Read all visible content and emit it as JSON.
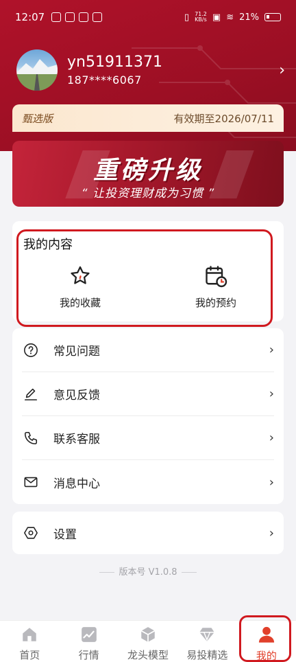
{
  "status_bar": {
    "time": "12:07",
    "net_speed_top": "71.2",
    "net_speed_unit": "KB/s",
    "battery": "21%"
  },
  "profile": {
    "username": "yn51911371",
    "phone": "187****6067"
  },
  "membership": {
    "tier": "甄选版",
    "expiry": "有效期至2026/07/11"
  },
  "banner": {
    "title": "重磅升级",
    "subtitle": "“ 让投资理财成为习惯 ”"
  },
  "my_content": {
    "heading": "我的内容",
    "items": [
      {
        "label": "我的收藏",
        "icon": "star-icon"
      },
      {
        "label": "我的预约",
        "icon": "calendar-clock-icon"
      }
    ]
  },
  "menu": {
    "items": [
      {
        "label": "常见问题",
        "icon": "question-circle-icon"
      },
      {
        "label": "意见反馈",
        "icon": "edit-pen-icon"
      },
      {
        "label": "联系客服",
        "icon": "phone-icon"
      },
      {
        "label": "消息中心",
        "icon": "mail-icon"
      }
    ],
    "settings_label": "设置"
  },
  "version": "版本号 V1.0.8",
  "tabs": [
    {
      "label": "首页",
      "icon": "home-icon"
    },
    {
      "label": "行情",
      "icon": "chart-icon"
    },
    {
      "label": "龙头模型",
      "icon": "cube-icon"
    },
    {
      "label": "易投精选",
      "icon": "diamond-icon"
    },
    {
      "label": "我的",
      "icon": "user-icon",
      "active": true
    }
  ],
  "colors": {
    "header": "#a8142a",
    "accent": "#e1402b",
    "highlight": "#d0191f"
  }
}
